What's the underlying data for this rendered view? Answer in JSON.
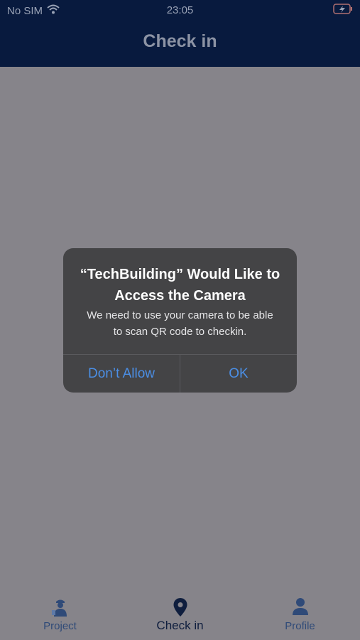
{
  "status_bar": {
    "carrier": "No SIM",
    "time": "23:05"
  },
  "nav": {
    "title": "Check in"
  },
  "alert": {
    "title_line1": "“TechBuilding” Would Like to",
    "title_line2": "Access the Camera",
    "message_line1": "We need to use your camera to be able",
    "message_line2": "to scan QR code to checkin.",
    "deny_label": "Don’t Allow",
    "ok_label": "OK"
  },
  "tabs": [
    {
      "label": "Project",
      "icon": "project-worker-icon",
      "active": false
    },
    {
      "label": "Check in",
      "icon": "location-pin-icon",
      "active": true
    },
    {
      "label": "Profile",
      "icon": "person-icon",
      "active": false
    }
  ],
  "colors": {
    "nav_bg": "#081a3e",
    "overlay": "#86848a",
    "alert_bg": "#444446",
    "link": "#4b8fe6"
  }
}
